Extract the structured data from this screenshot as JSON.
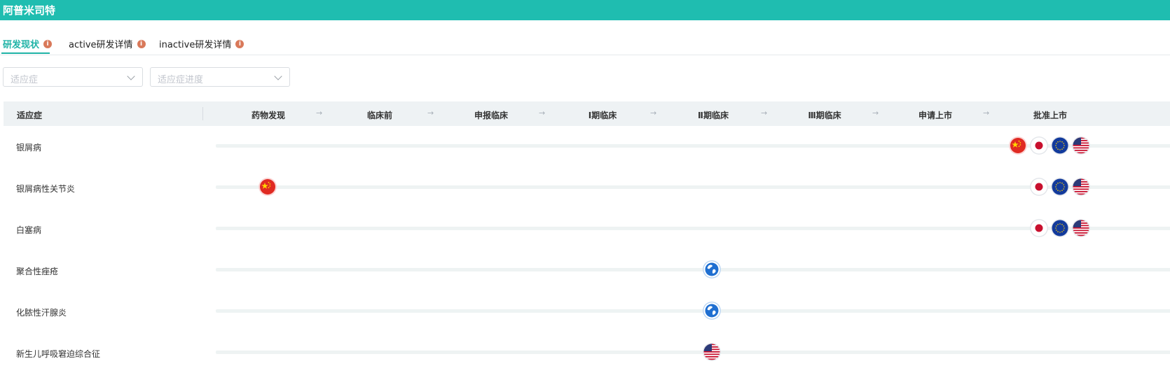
{
  "app": {
    "title": "阿普米司特"
  },
  "tabs": [
    {
      "label": "研发现状",
      "active": true
    },
    {
      "label": "active研发详情",
      "active": false
    },
    {
      "label": "inactive研发详情",
      "active": false
    }
  ],
  "filters": {
    "indication_placeholder": "适应症",
    "progress_placeholder": "适应症进度"
  },
  "table": {
    "indication_header": "适应症",
    "stages": [
      "药物发现",
      "临床前",
      "申报临床",
      "Ⅰ期临床",
      "Ⅱ期临床",
      "Ⅲ期临床",
      "申请上市",
      "批准上市"
    ],
    "rows": [
      {
        "name": "银屑病",
        "markers": [
          {
            "stage": "批准上市",
            "regions": [
              "china",
              "japan",
              "eu",
              "usa"
            ]
          }
        ]
      },
      {
        "name": "银屑病性关节炎",
        "markers": [
          {
            "stage": "药物发现",
            "regions": [
              "china"
            ]
          },
          {
            "stage": "批准上市",
            "regions": [
              "japan",
              "eu",
              "usa"
            ]
          }
        ]
      },
      {
        "name": "白塞病",
        "markers": [
          {
            "stage": "批准上市",
            "regions": [
              "japan",
              "eu",
              "usa"
            ]
          }
        ]
      },
      {
        "name": "聚合性痤疮",
        "markers": [
          {
            "stage": "Ⅱ期临床",
            "regions": [
              "global"
            ]
          }
        ]
      },
      {
        "name": "化脓性汗腺炎",
        "markers": [
          {
            "stage": "Ⅱ期临床",
            "regions": [
              "global"
            ]
          }
        ]
      },
      {
        "name": "新生儿呼吸窘迫综合征",
        "markers": [
          {
            "stage": "Ⅱ期临床",
            "regions": [
              "usa"
            ]
          }
        ]
      }
    ]
  },
  "colors": {
    "brand": "#1fbdb0",
    "accent": "#1fb3a6",
    "info_icon": "#d9795a",
    "track": "#eef3f3"
  },
  "icons": {
    "tab_info": "info-icon",
    "dropdown": "chevron-down-icon",
    "stage_arrow": "arrow-right-icon"
  }
}
